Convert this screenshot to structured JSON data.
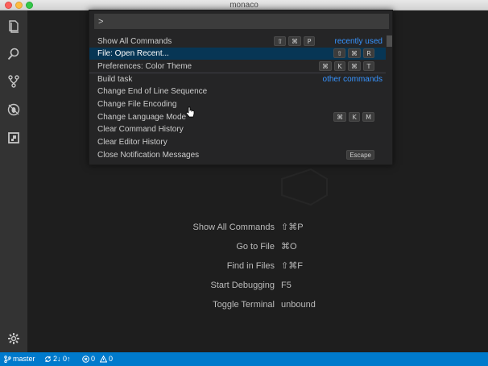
{
  "window": {
    "title": "monaco"
  },
  "activity_bar": {
    "items": [
      {
        "name": "explorer-icon"
      },
      {
        "name": "search-icon"
      },
      {
        "name": "source-control-icon"
      },
      {
        "name": "debug-icon"
      },
      {
        "name": "extensions-icon"
      }
    ],
    "bottom": {
      "name": "settings-gear-icon"
    }
  },
  "quick_open": {
    "input_value": ">",
    "items": [
      {
        "label": "Show All Commands",
        "keys": [
          "⇧",
          "⌘",
          "P"
        ],
        "hint": "recently used"
      },
      {
        "label": "File: Open Recent...",
        "keys": [
          "⇧",
          "⌘",
          "R"
        ],
        "hint": ""
      },
      {
        "label": "Preferences: Color Theme",
        "keys": [
          "⌘",
          "K",
          "⌘",
          "T"
        ],
        "hint": ""
      },
      {
        "label": "Build task",
        "keys": [],
        "hint": "other commands"
      },
      {
        "label": "Change End of Line Sequence",
        "keys": [],
        "hint": ""
      },
      {
        "label": "Change File Encoding",
        "keys": [],
        "hint": ""
      },
      {
        "label": "Change Language Mode",
        "keys": [
          "⌘",
          "K",
          "M"
        ],
        "hint": ""
      },
      {
        "label": "Clear Command History",
        "keys": [],
        "hint": ""
      },
      {
        "label": "Clear Editor History",
        "keys": [],
        "hint": ""
      },
      {
        "label": "Close Notification Messages",
        "keys": [
          "Escape"
        ],
        "hint": ""
      }
    ],
    "selected_index": 1
  },
  "shortcuts": [
    {
      "label": "Show All Commands",
      "key": "⇧⌘P"
    },
    {
      "label": "Go to File",
      "key": "⌘O"
    },
    {
      "label": "Find in Files",
      "key": "⇧⌘F"
    },
    {
      "label": "Start Debugging",
      "key": "F5"
    },
    {
      "label": "Toggle Terminal",
      "key": "unbound"
    }
  ],
  "status_bar": {
    "branch": "master",
    "sync": "2↓ 0↑",
    "errors": "0",
    "warnings": "0",
    "accent": "#007acc"
  }
}
